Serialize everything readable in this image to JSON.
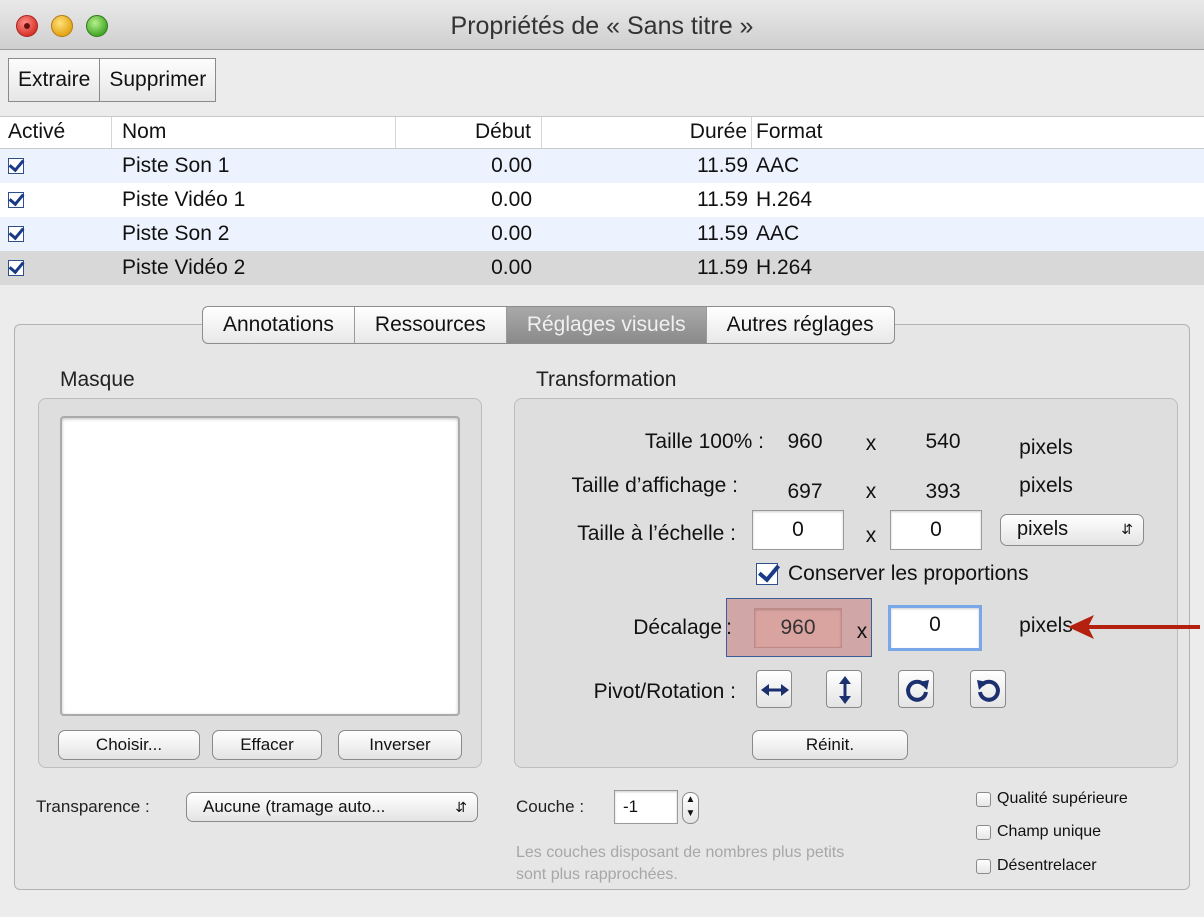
{
  "window": {
    "title": "Propriétés de « Sans titre »"
  },
  "toolbar": {
    "extract_label": "Extraire",
    "delete_label": "Supprimer"
  },
  "table": {
    "headers": {
      "active": "Activé",
      "name": "Nom",
      "start": "Début",
      "duration": "Durée",
      "format": "Format"
    },
    "rows": [
      {
        "active": true,
        "name": "Piste Son 1",
        "start": "0.00",
        "duration": "11.59",
        "format": "AAC"
      },
      {
        "active": true,
        "name": "Piste Vidéo 1",
        "start": "0.00",
        "duration": "11.59",
        "format": "H.264"
      },
      {
        "active": true,
        "name": "Piste Son 2",
        "start": "0.00",
        "duration": "11.59",
        "format": "AAC"
      },
      {
        "active": true,
        "name": "Piste Vidéo 2",
        "start": "0.00",
        "duration": "11.59",
        "format": "H.264"
      }
    ],
    "selected_row": "Piste Vidéo 2"
  },
  "tabs": {
    "annotations": "Annotations",
    "resources": "Ressources",
    "visual": "Réglages visuels",
    "other": "Autres réglages",
    "active": "Réglages visuels"
  },
  "mask": {
    "label": "Masque",
    "choose": "Choisir...",
    "clear": "Effacer",
    "invert": "Inverser"
  },
  "transparency": {
    "label": "Transparence :",
    "value": "Aucune (tramage auto..."
  },
  "transform": {
    "label": "Transformation",
    "size100_label": "Taille 100% :",
    "size100_w": "960",
    "size100_h": "540",
    "display_label": "Taille d’affichage :",
    "display_w": "697",
    "display_h": "393",
    "scale_label": "Taille à l’échelle :",
    "scale_w": "0",
    "scale_h": "0",
    "scale_unit": "pixels",
    "keep_ratio_label": "Conserver les proportions",
    "keep_ratio": true,
    "offset_label": "Décalage",
    "offset_colon": ":",
    "offset_x": "960",
    "offset_y": "0",
    "x": "x",
    "unit": "pixels",
    "pivot_label": "Pivot/Rotation :",
    "reset": "Réinit."
  },
  "layer": {
    "label": "Couche :",
    "value": "-1",
    "hint_line1": "Les couches disposant de nombres plus petits",
    "hint_line2": "sont plus rapprochées."
  },
  "options": {
    "high_quality": "Qualité supérieure",
    "single_field": "Champ unique",
    "deinterlace": "Désentrelacer"
  },
  "colors": {
    "annotation_arrow": "#b5210f",
    "highlight": "#d9a3a0",
    "selection": "#7aa7e8"
  },
  "icons": [
    "flip-horizontal-icon",
    "flip-vertical-icon",
    "rotate-clockwise-icon",
    "rotate-counterclockwise-icon",
    "annotation-arrow-icon"
  ]
}
